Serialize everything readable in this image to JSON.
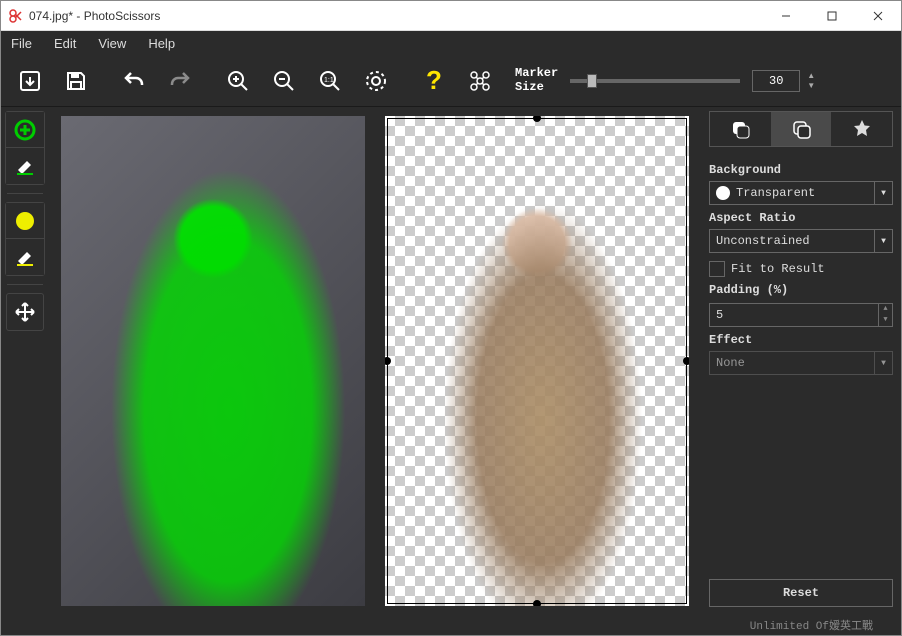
{
  "window": {
    "title": "074.jpg* - PhotoScissors"
  },
  "menu": {
    "file": "File",
    "edit": "Edit",
    "view": "View",
    "help": "Help"
  },
  "toolbar": {
    "marker_label": "Marker\nSize",
    "marker_size": "30"
  },
  "panel": {
    "background_label": "Background",
    "background_value": "Transparent",
    "aspect_label": "Aspect Ratio",
    "aspect_value": "Unconstrained",
    "fit_label": "Fit to Result",
    "padding_label": "Padding (%)",
    "padding_value": "5",
    "effect_label": "Effect",
    "effect_value": "None",
    "reset_label": "Reset"
  },
  "status": {
    "text": "Unlimited Of嫒英工戰"
  }
}
